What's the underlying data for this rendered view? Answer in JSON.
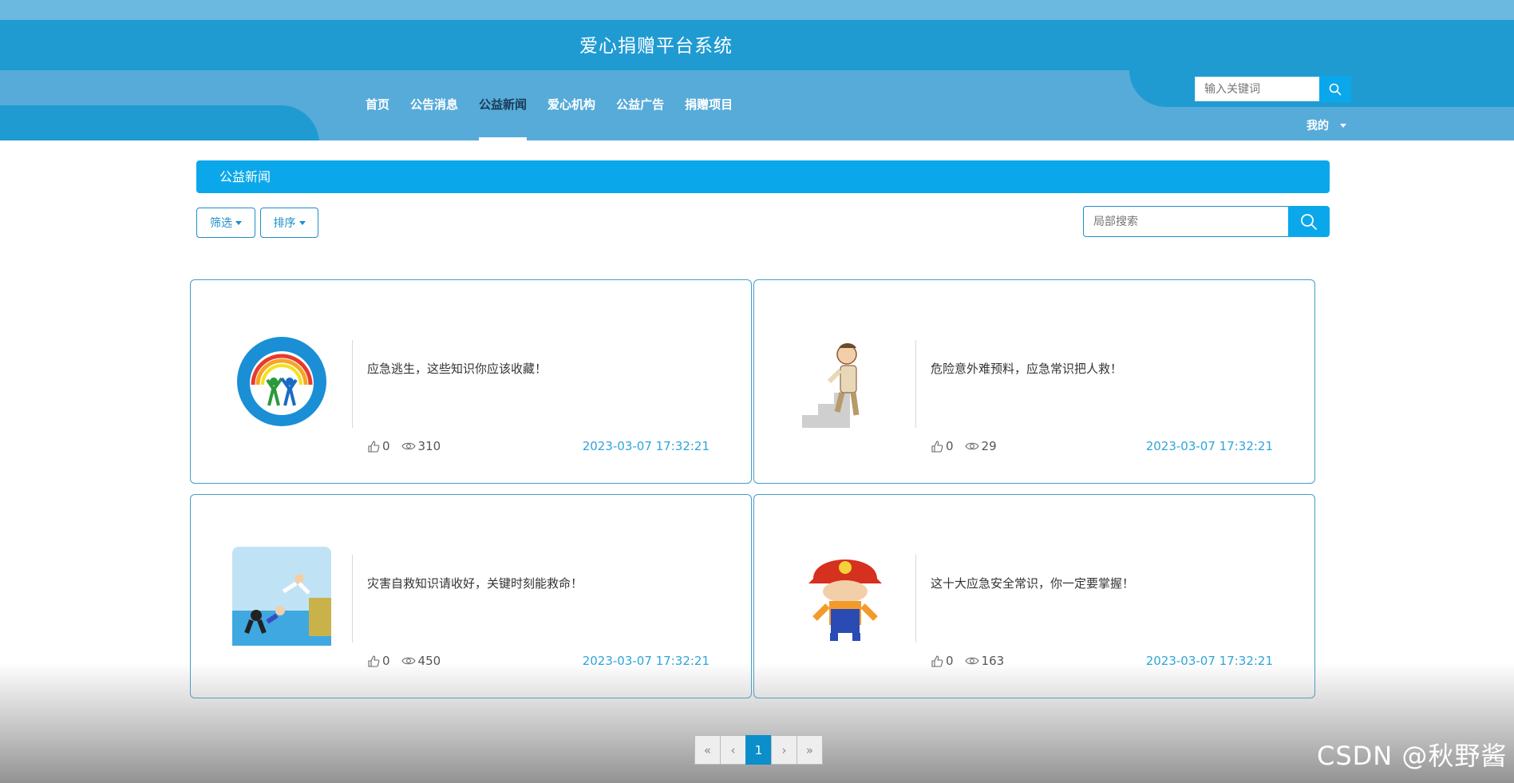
{
  "site": {
    "title": "爱心捐赠平台系统"
  },
  "nav": {
    "items": [
      {
        "label": "首页"
      },
      {
        "label": "公告消息"
      },
      {
        "label": "公益新闻"
      },
      {
        "label": "爱心机构"
      },
      {
        "label": "公益广告"
      },
      {
        "label": "捐赠项目"
      }
    ],
    "active_index": 2
  },
  "header_search": {
    "placeholder": "输入关键词",
    "icon": "search-icon"
  },
  "user_menu": {
    "label": "我的",
    "icon": "caret-down-icon"
  },
  "section": {
    "title": "公益新闻"
  },
  "toolbar": {
    "filter_label": "筛选",
    "sort_label": "排序",
    "search_placeholder": "局部搜索"
  },
  "cards": [
    {
      "title": "应急逃生，这些知识你应该收藏！",
      "likes": "0",
      "views": "310",
      "date": "2023-03-07 17:32:21",
      "image": "disaster-day-logo"
    },
    {
      "title": "危险意外难预料，应急常识把人救！",
      "likes": "0",
      "views": "29",
      "date": "2023-03-07 17:32:21",
      "image": "man-on-stairs-cartoon"
    },
    {
      "title": "灾害自救知识请收好，关键时刻能救命！",
      "likes": "0",
      "views": "450",
      "date": "2023-03-07 17:32:21",
      "image": "drowning-rescue-cartoon"
    },
    {
      "title": "这十大应急安全常识，你一定要掌握！",
      "likes": "0",
      "views": "163",
      "date": "2023-03-07 17:32:21",
      "image": "helmet-worker-cartoon"
    }
  ],
  "pagination": {
    "first": "«",
    "prev": "‹",
    "current": "1",
    "next": "›",
    "last": "»"
  },
  "colors": {
    "primary": "#0aa8ea",
    "header": "#1f9bd2",
    "accent_text": "#2fa5d8",
    "border": "#3f9fc9"
  },
  "watermark": "CSDN @秋野酱"
}
